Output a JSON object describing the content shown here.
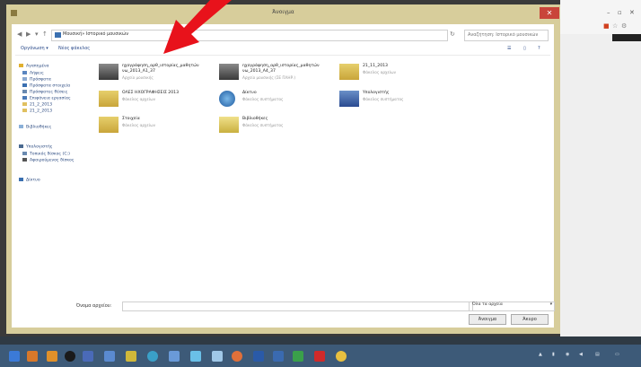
{
  "window": {
    "title": "Άνοιγμα"
  },
  "address": {
    "path": "Μουσική» Ιστορικό μουσικών",
    "search_placeholder": "Αναζήτηση: Ιστορικό μουσικών"
  },
  "toolbar": {
    "organize": "Οργάνωση ▾",
    "new_folder": "Νέος φάκελος"
  },
  "nav": {
    "favorites": "Αγαπημένα",
    "items": [
      "Λήψεις",
      "Πρόσφατα",
      "Πρόσφατα στοιχεία",
      "Πρόσφατες θέσεις",
      "Επιφάνεια εργασίας",
      "21_2_2013",
      "21_2_2013"
    ],
    "libraries": "Βιβλιοθήκες",
    "computer": "Υπολογιστής",
    "drives": [
      "Τοπικός δίσκος (C:)",
      "Αφαιρούμενος δίσκος"
    ],
    "network": "Δίκτυο"
  },
  "files": [
    {
      "name": "ηχογράφηση_αρθ_ιστορίας_μαθητών\nνω_2013_Α1_37",
      "desc": "Αρχείο μουσικής"
    },
    {
      "name": "ηχογράφηση_αρθ_ιστορίας_μαθητών\nνω_2013_Α4_37",
      "desc": "Αρχείο μουσικής (ΣΕ ΠΛΗΡ.)"
    },
    {
      "name": "21_11_2013",
      "desc": "Φάκελος αρχείων"
    },
    {
      "name": "ΟΛΕΣ ΗΧΟΓΡΑΦΗΣΕΙΣ 2013",
      "desc": "Φάκελος αρχείων"
    },
    {
      "name": "Δίκτυο",
      "desc": "Φάκελος συστήματος"
    },
    {
      "name": "Υπολογιστής",
      "desc": "Φάκελος συστήματος"
    },
    {
      "name": "Στοιχεία",
      "desc": "Φάκελος αρχείων"
    },
    {
      "name": "Βιβλιοθήκες",
      "desc": "Φάκελος συστήματος"
    }
  ],
  "bottom": {
    "filename_label": "Όνομα αρχείου:",
    "filename_value": "",
    "filetype": "Όλα τα αρχεία",
    "open_label": "Άνοιγμα",
    "cancel_label": "Άκυρο"
  },
  "colors": {
    "dialog_frame": "#d7cd9b",
    "close": "#c9453a",
    "taskbar": "#3d5a78",
    "arrow": "#e8121b"
  }
}
